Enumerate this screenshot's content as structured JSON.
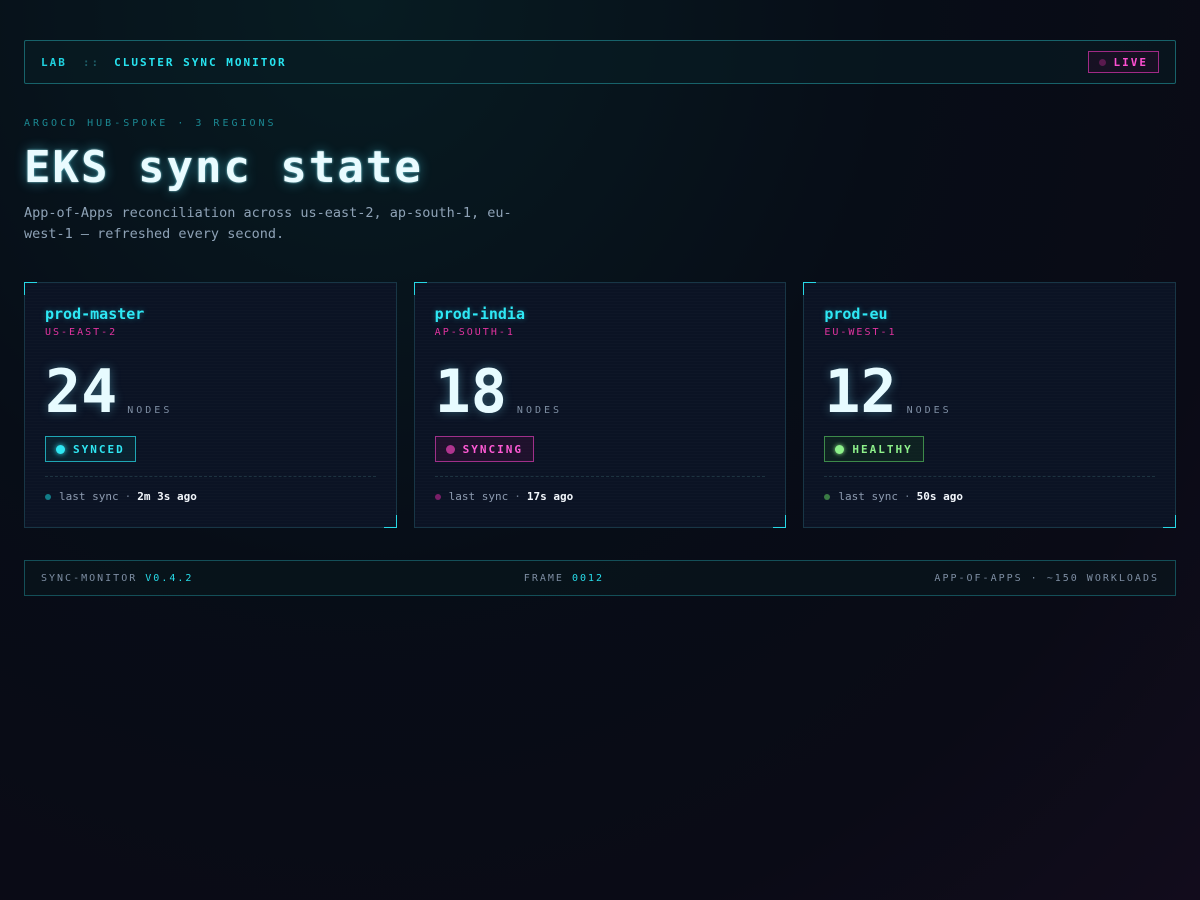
{
  "topbar": {
    "lab": "LAB",
    "separator": "::",
    "title": "CLUSTER SYNC MONITOR",
    "live_label": "LIVE"
  },
  "hero": {
    "eyebrow": "ARGOCD HUB-SPOKE · 3 REGIONS",
    "title": "EKS sync state",
    "subtitle": "App-of-Apps reconciliation across us-east-2, ap-south-1, eu-west-1 — refreshed every second."
  },
  "clusters": [
    {
      "name": "prod-master",
      "region": "US-EAST-2",
      "nodes": "24",
      "nodes_label": "NODES",
      "status": "SYNCED",
      "last_sync_label": "last sync",
      "last_sync_sep": "·",
      "last_sync_value": "2m 3s ago"
    },
    {
      "name": "prod-india",
      "region": "AP-SOUTH-1",
      "nodes": "18",
      "nodes_label": "NODES",
      "status": "SYNCING",
      "last_sync_label": "last sync",
      "last_sync_sep": "·",
      "last_sync_value": "17s ago"
    },
    {
      "name": "prod-eu",
      "region": "EU-WEST-1",
      "nodes": "12",
      "nodes_label": "NODES",
      "status": "HEALTHY",
      "last_sync_label": "last sync",
      "last_sync_sep": "·",
      "last_sync_value": "50s ago"
    }
  ],
  "footer": {
    "app_label": "SYNC-MONITOR",
    "version": "V0.4.2",
    "frame_label": "FRAME",
    "frame_value": "0012",
    "summary": "APP-OF-APPS · ~150 WORKLOADS"
  },
  "colors": {
    "accent_cyan": "#2ee8f5",
    "accent_magenta": "#e0339f",
    "status_synced": "#2fe6f2",
    "status_syncing": "#ff5ad5",
    "status_healthy": "#8df08a"
  }
}
